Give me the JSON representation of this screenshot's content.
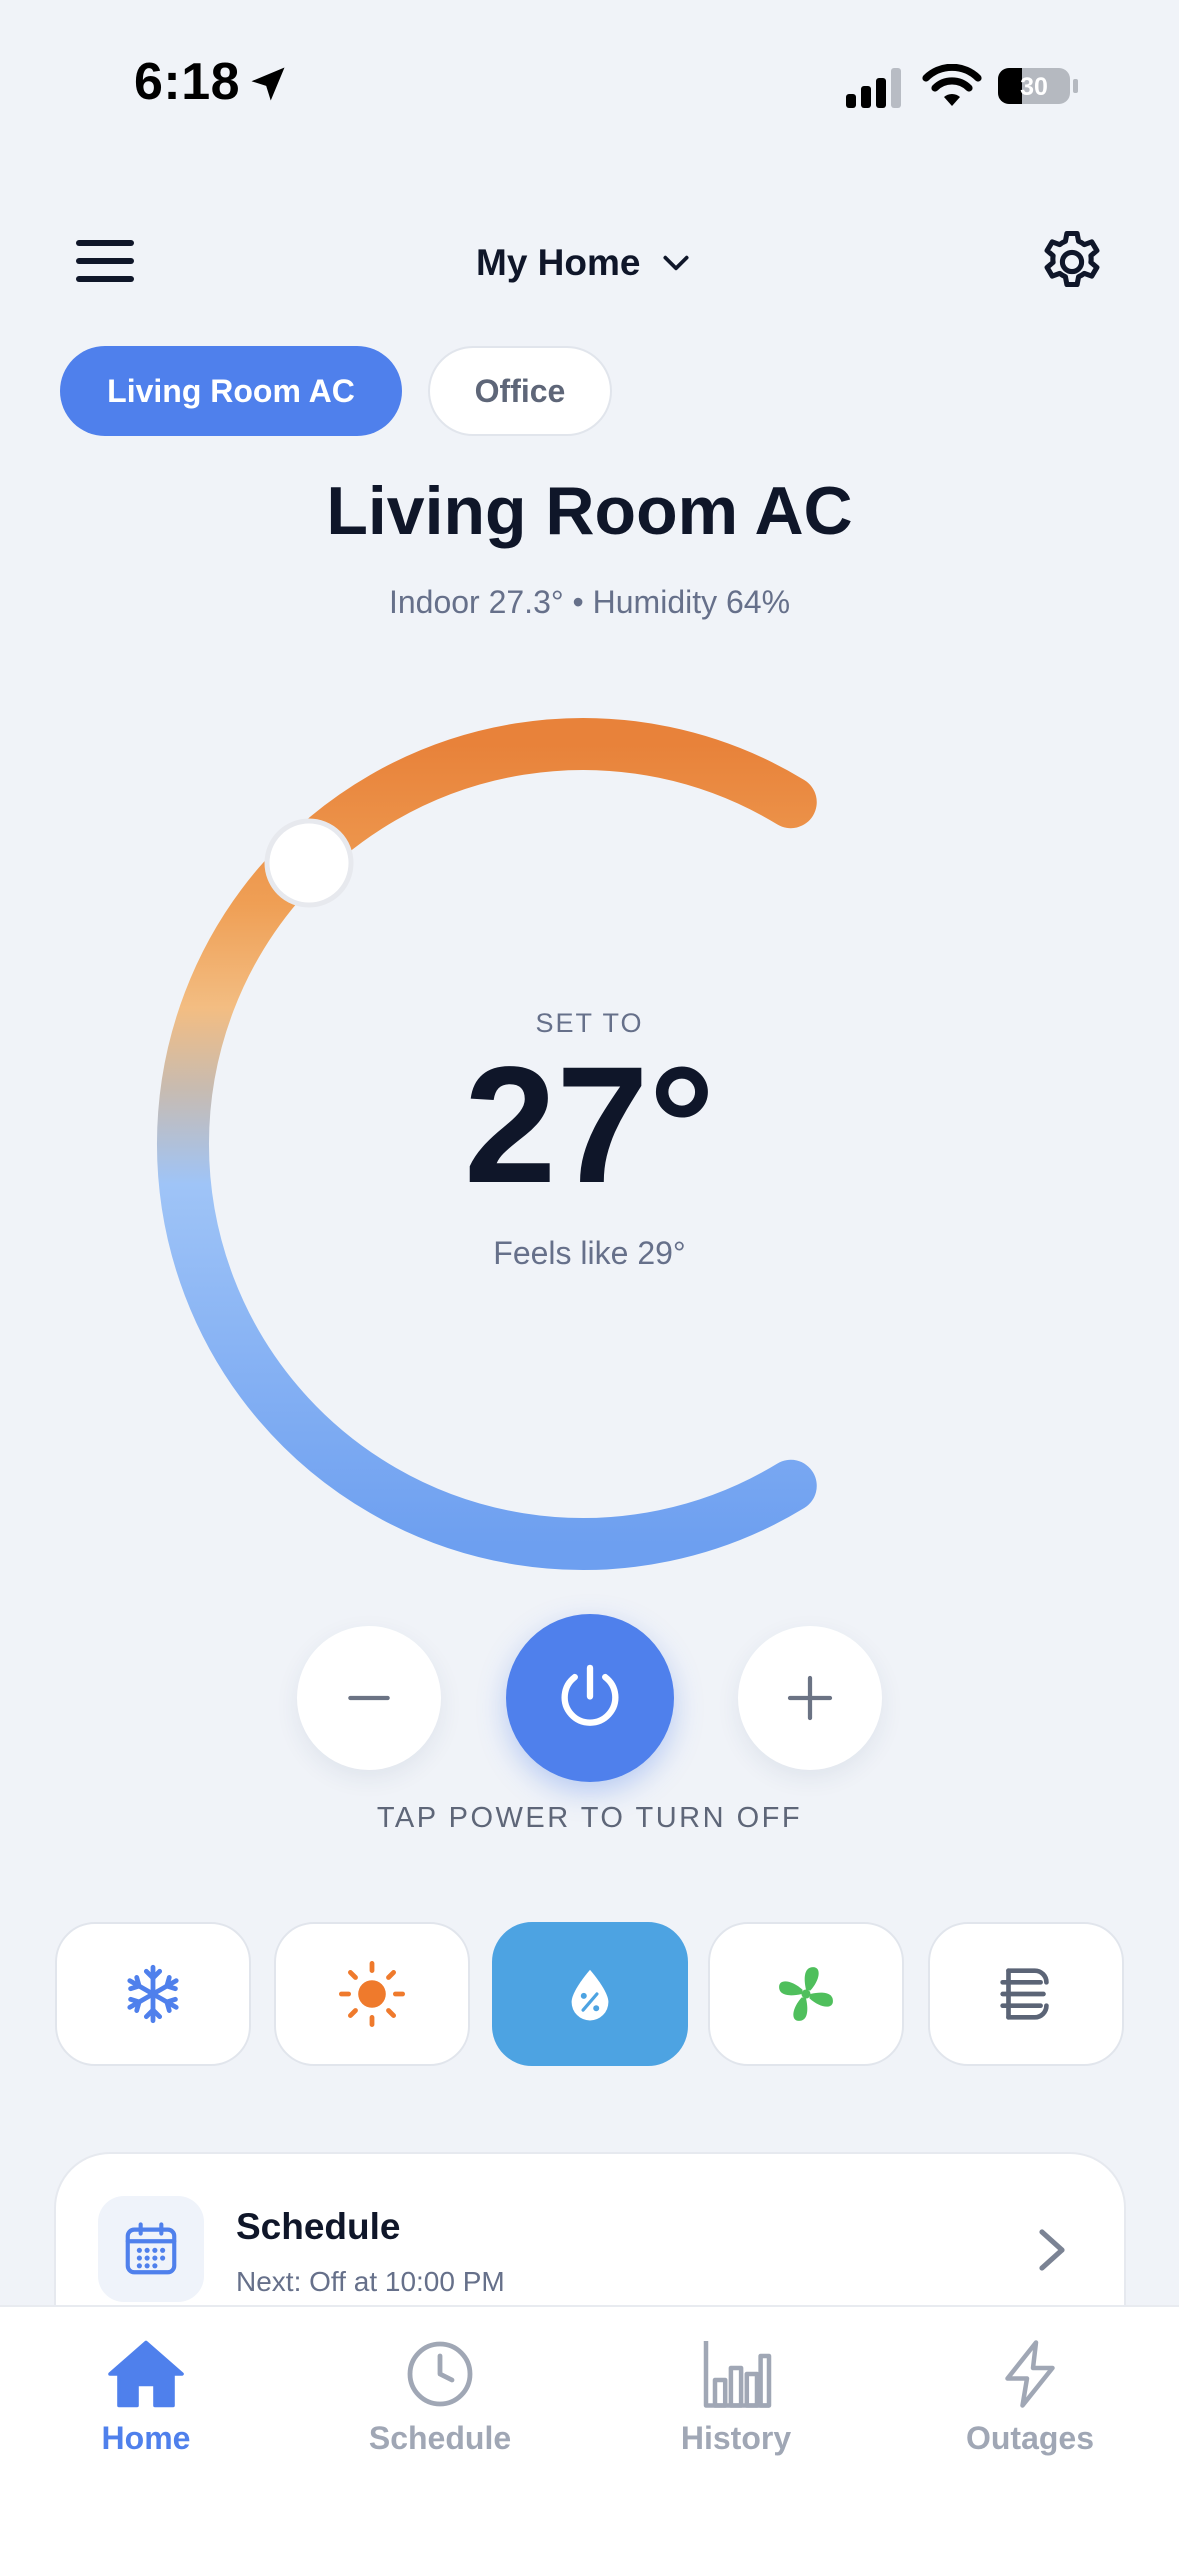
{
  "status_bar": {
    "time": "6:18",
    "battery": "30"
  },
  "header": {
    "home_name": "My Home"
  },
  "tabs": [
    {
      "label": "Living Room AC",
      "active": true
    },
    {
      "label": "Office",
      "active": false
    }
  ],
  "device": {
    "name": "Living Room AC",
    "subtitle": "Indoor 27.3° • Humidity 64%",
    "set_to_label": "SET TO",
    "set_temp": "27°",
    "feels_like": "Feels like 29°"
  },
  "controls": {
    "power_hint": "TAP POWER TO TURN OFF",
    "power_color": "#4f80ec"
  },
  "modes": [
    {
      "name": "cool",
      "icon": "snowflake-icon",
      "active": false
    },
    {
      "name": "heat",
      "icon": "sun-icon",
      "active": false
    },
    {
      "name": "dry",
      "icon": "humidity-drop-icon",
      "active": true
    },
    {
      "name": "fan",
      "icon": "fan-icon",
      "active": false
    },
    {
      "name": "auto",
      "icon": "wind-icon",
      "active": false
    }
  ],
  "schedule": {
    "title": "Schedule",
    "next": "Next: Off at 10:00 PM"
  },
  "nav": [
    {
      "label": "Home",
      "icon": "home-icon",
      "active": true
    },
    {
      "label": "Schedule",
      "icon": "clock-icon",
      "active": false
    },
    {
      "label": "History",
      "icon": "bar-chart-icon",
      "active": false
    },
    {
      "label": "Outages",
      "icon": "lightning-icon",
      "active": false
    }
  ],
  "colors": {
    "accent": "#4f80ec",
    "warm": "#eb8339",
    "cool": "#77a8f4",
    "active_mode": "#4da3e2"
  }
}
